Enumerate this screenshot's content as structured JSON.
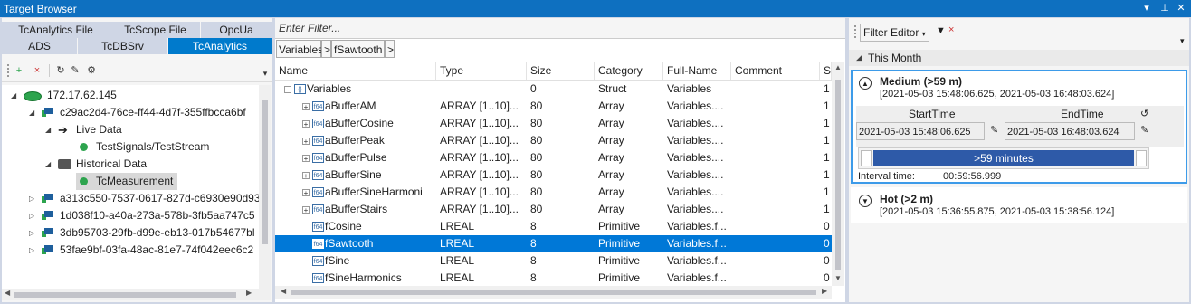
{
  "window": {
    "title": "Target Browser",
    "controls": [
      "▾",
      "⊥",
      "✕"
    ]
  },
  "left": {
    "tabs_row1": [
      {
        "label": "TcAnalytics File",
        "active": false
      },
      {
        "label": "TcScope File",
        "active": false
      },
      {
        "label": "OpcUa",
        "active": false
      }
    ],
    "tabs_row2": [
      {
        "label": "ADS",
        "active": false
      },
      {
        "label": "TcDBSrv",
        "active": false
      },
      {
        "label": "TcAnalytics",
        "active": true
      }
    ],
    "tree": [
      {
        "label": "172.17.62.145",
        "icon": "network-icon",
        "expanded": true
      },
      {
        "label": "c29ac2d4-76ce-ff44-4d7f-355ffbcca6bf",
        "icon": "pc-icon",
        "expanded": true
      },
      {
        "label": "Live Data",
        "icon": "arrow-icon",
        "expanded": true
      },
      {
        "label": "TestSignals/TestStream",
        "icon": "green-dot-icon"
      },
      {
        "label": "Historical Data",
        "icon": "database-icon",
        "expanded": true
      },
      {
        "label": "TcMeasurement",
        "icon": "green-dot-icon",
        "selected": true
      },
      {
        "label": "a313c550-7537-0617-827d-c6930e90d93",
        "icon": "pc-icon",
        "expanded": false
      },
      {
        "label": "1d038f10-a40a-273a-578b-3fb5aa747c5",
        "icon": "pc-icon",
        "expanded": false
      },
      {
        "label": "3db95703-29fb-d99e-eb13-017b54677bl",
        "icon": "pc-icon",
        "expanded": false
      },
      {
        "label": "53fae9bf-03fa-48ac-81e7-74f042eec6c2",
        "icon": "pc-icon",
        "expanded": false
      }
    ]
  },
  "mid": {
    "filter_placeholder": "Enter Filter...",
    "breadcrumb": [
      "Variables",
      ">",
      "fSawtooth",
      ">"
    ],
    "columns": [
      "Name",
      "Type",
      "Size",
      "Category",
      "Full-Name",
      "Comment",
      "S"
    ],
    "rows": [
      {
        "name": "Variables",
        "type": "",
        "size": "0",
        "category": "Struct",
        "full": "Variables",
        "s": "1",
        "kind": "struct",
        "level": 0,
        "exp": "minus"
      },
      {
        "name": "aBufferAM",
        "type": "ARRAY [1..10]...",
        "size": "80",
        "category": "Array",
        "full": "Variables....",
        "s": "1",
        "kind": "f64",
        "level": 1,
        "exp": "plus"
      },
      {
        "name": "aBufferCosine",
        "type": "ARRAY [1..10]...",
        "size": "80",
        "category": "Array",
        "full": "Variables....",
        "s": "1",
        "kind": "f64",
        "level": 1,
        "exp": "plus"
      },
      {
        "name": "aBufferPeak",
        "type": "ARRAY [1..10]...",
        "size": "80",
        "category": "Array",
        "full": "Variables....",
        "s": "1",
        "kind": "f64",
        "level": 1,
        "exp": "plus"
      },
      {
        "name": "aBufferPulse",
        "type": "ARRAY [1..10]...",
        "size": "80",
        "category": "Array",
        "full": "Variables....",
        "s": "1",
        "kind": "f64",
        "level": 1,
        "exp": "plus"
      },
      {
        "name": "aBufferSine",
        "type": "ARRAY [1..10]...",
        "size": "80",
        "category": "Array",
        "full": "Variables....",
        "s": "1",
        "kind": "f64",
        "level": 1,
        "exp": "plus"
      },
      {
        "name": "aBufferSineHarmoni",
        "type": "ARRAY [1..10]...",
        "size": "80",
        "category": "Array",
        "full": "Variables....",
        "s": "1",
        "kind": "f64",
        "level": 1,
        "exp": "plus"
      },
      {
        "name": "aBufferStairs",
        "type": "ARRAY [1..10]...",
        "size": "80",
        "category": "Array",
        "full": "Variables....",
        "s": "1",
        "kind": "f64",
        "level": 1,
        "exp": "plus"
      },
      {
        "name": "fCosine",
        "type": "LREAL",
        "size": "8",
        "category": "Primitive",
        "full": "Variables.f...",
        "s": "0",
        "kind": "f64",
        "level": 1,
        "exp": ""
      },
      {
        "name": "fSawtooth",
        "type": "LREAL",
        "size": "8",
        "category": "Primitive",
        "full": "Variables.f...",
        "s": "0",
        "kind": "f64",
        "level": 1,
        "exp": "",
        "selected": true
      },
      {
        "name": "fSine",
        "type": "LREAL",
        "size": "8",
        "category": "Primitive",
        "full": "Variables.f...",
        "s": "0",
        "kind": "f64",
        "level": 1,
        "exp": ""
      },
      {
        "name": "fSineHarmonics",
        "type": "LREAL",
        "size": "8",
        "category": "Primitive",
        "full": "Variables.f...",
        "s": "0",
        "kind": "f64",
        "level": 1,
        "exp": ""
      }
    ]
  },
  "right": {
    "filter_editor_label": "Filter Editor",
    "group_label": "This Month",
    "medium": {
      "title": "Medium (>59 m)",
      "range": "[2021-05-03 15:48:06.625, 2021-05-03 16:48:03.624]",
      "start_label": "StartTime",
      "end_label": "EndTime",
      "start_value": "2021-05-03 15:48:06.625",
      "end_value": "2021-05-03 16:48:03.624",
      "slider_label": ">59 minutes",
      "interval_label": "Interval time:",
      "interval_value": "00:59:56.999"
    },
    "hot": {
      "title": "Hot (>2 m)",
      "range": "[2021-05-03 15:36:55.875, 2021-05-03 15:38:56.124]"
    }
  },
  "colors": {
    "accent": "#007acc",
    "selection": "#0078d7",
    "slider": "#2e5aa8",
    "online": "#2da44e"
  }
}
